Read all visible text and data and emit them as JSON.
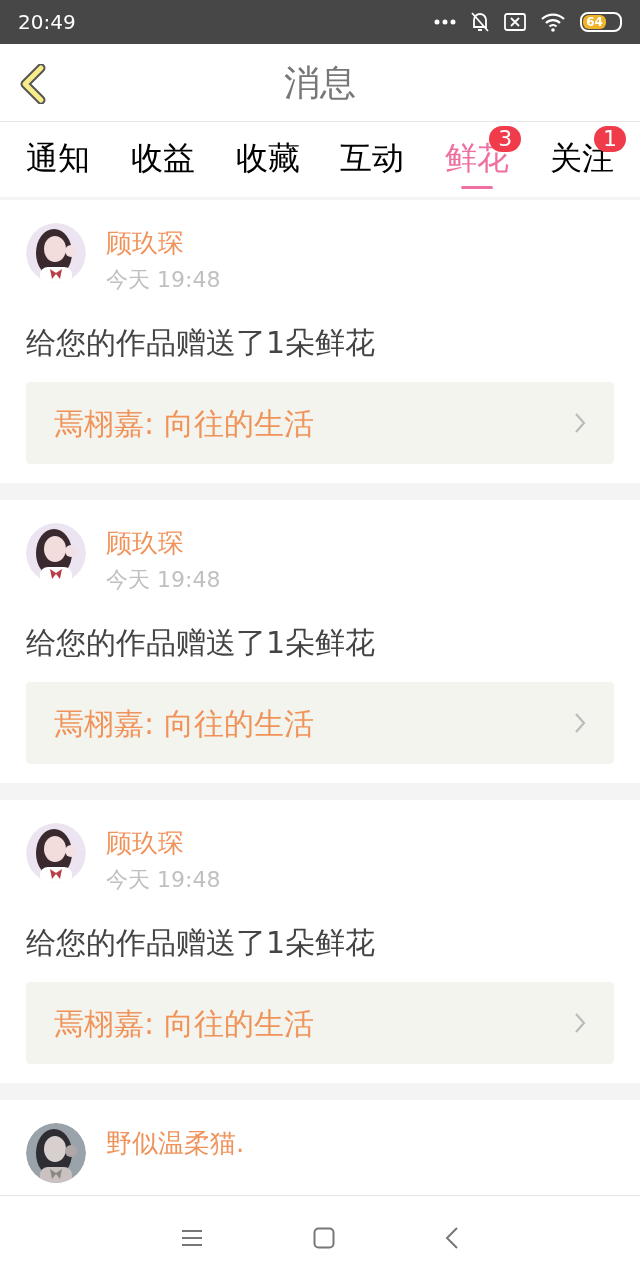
{
  "status_bar": {
    "time": "20:49",
    "battery": "64"
  },
  "header": {
    "title": "消息"
  },
  "tabs": [
    {
      "label": "通知",
      "selected": false
    },
    {
      "label": "收益",
      "selected": false
    },
    {
      "label": "收藏",
      "selected": false
    },
    {
      "label": "互动",
      "selected": false
    },
    {
      "label": "鲜花",
      "selected": true,
      "badge": "3"
    },
    {
      "label": "关注",
      "selected": false,
      "badge": "1"
    }
  ],
  "messages": [
    {
      "name": "顾玖琛",
      "time": "今天 19:48",
      "text": "给您的作品赠送了1朵鲜花",
      "work": "焉栩嘉: 向往的生活"
    },
    {
      "name": "顾玖琛",
      "time": "今天 19:48",
      "text": "给您的作品赠送了1朵鲜花",
      "work": "焉栩嘉: 向往的生活"
    },
    {
      "name": "顾玖琛",
      "time": "今天 19:48",
      "text": "给您的作品赠送了1朵鲜花",
      "work": "焉栩嘉: 向往的生活"
    },
    {
      "name": "野似温柔猫."
    }
  ]
}
